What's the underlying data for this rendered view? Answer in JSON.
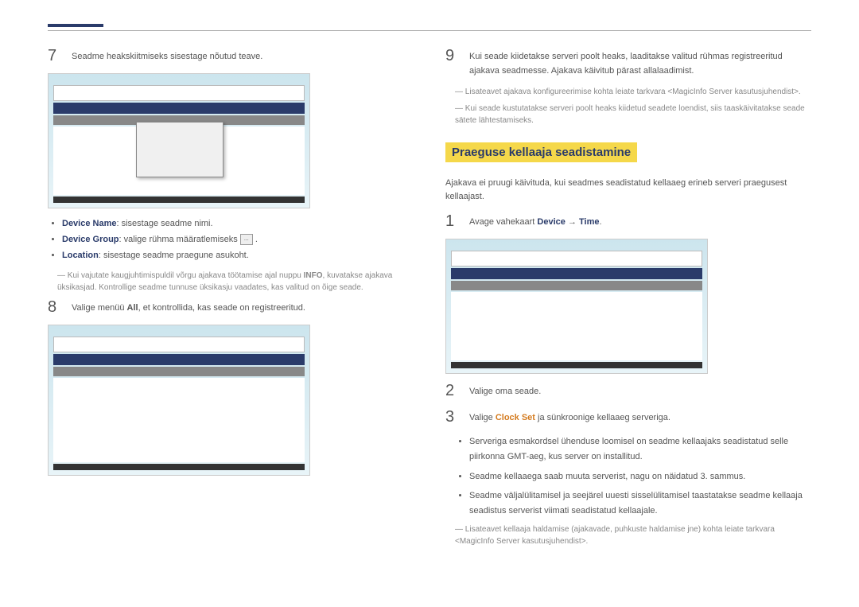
{
  "left": {
    "step7": {
      "num": "7",
      "text": "Seadme heakskiitmiseks sisestage nõutud teave."
    },
    "bullets": {
      "b1_label": "Device Name",
      "b1_text": ": sisestage seadme nimi.",
      "b2_label": "Device Group",
      "b2_text": ": valige rühma määratlemiseks ",
      "b3_label": "Location",
      "b3_text": ": sisestage seadme praegune asukoht."
    },
    "note1a": "Kui vajutate kaugjuhtimispuldil võrgu ajakava töötamise ajal nuppu ",
    "note1b": "INFO",
    "note1c": ", kuvatakse ajakava üksikasjad. Kontrollige seadme tunnuse üksikasju vaadates, kas valitud on õige seade.",
    "step8": {
      "num": "8",
      "text_a": "Valige menüü ",
      "text_b": "All",
      "text_c": ", et kontrollida, kas seade on registreeritud."
    }
  },
  "right": {
    "step9": {
      "num": "9",
      "text": "Kui seade kiidetakse serveri poolt heaks, laaditakse valitud rühmas registreeritud ajakava seadmesse. Ajakava käivitub pärast allalaadimist."
    },
    "note2a": "Lisateavet ajakava konfigureerimise kohta leiate tarkvara <",
    "note2b": "MagicInfo Server",
    "note2c": " kasutusjuhendist>.",
    "note3": "Kui seade kustutatakse serveri poolt heaks kiidetud seadete loendist, siis taaskäivitatakse seade sätete lähtestamiseks.",
    "heading": "Praeguse kellaaja seadistamine",
    "intro": "Ajakava ei pruugi käivituda, kui seadmes seadistatud kellaaeg erineb serveri praegusest kellaajast.",
    "step1": {
      "num": "1",
      "text_a": "Avage vahekaart ",
      "text_b": "Device",
      "text_c": " → ",
      "text_d": "Time",
      "text_e": "."
    },
    "step2": {
      "num": "2",
      "text": "Valige oma seade."
    },
    "step3": {
      "num": "3",
      "text_a": "Valige ",
      "text_b": "Clock Set",
      "text_c": " ja sünkroonige kellaaeg serveriga."
    },
    "sub_bullets": {
      "sb1": "Serveriga esmakordsel ühenduse loomisel on seadme kellaajaks seadistatud selle piirkonna GMT-aeg, kus server on installitud.",
      "sb2": "Seadme kellaaega saab muuta serverist, nagu on näidatud 3. sammus.",
      "sb3": "Seadme väljalülitamisel ja seejärel uuesti sisselülitamisel taastatakse seadme kellaaja seadistus serverist viimati seadistatud kellaajale."
    },
    "note4a": "Lisateavet kellaaja haldamise (ajakavade, puhkuste haldamise jne) kohta leiate tarkvara <",
    "note4b": "MagicInfo Server",
    "note4c": " kasutusjuhendist>."
  },
  "icons": {
    "browse": "..."
  }
}
